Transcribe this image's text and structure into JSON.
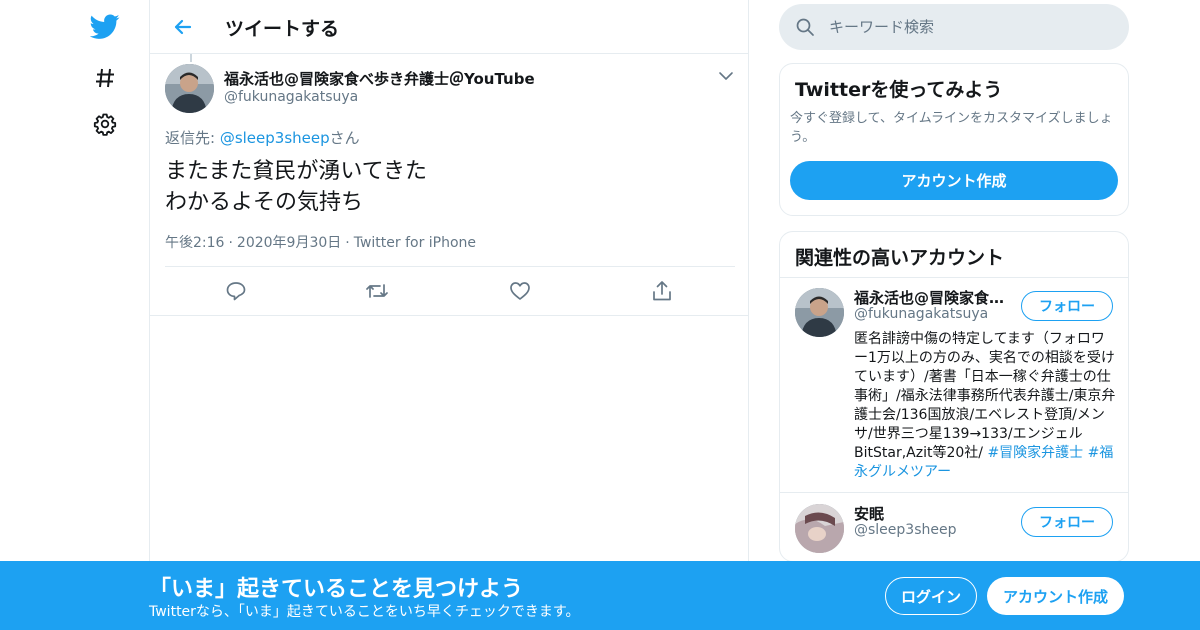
{
  "colors": {
    "accent": "#1da1f2",
    "link": "#1b95e0",
    "muted": "#657786",
    "border": "#e6ecf0"
  },
  "nav": {
    "icons": [
      "twitter-bird-icon",
      "hashtag-icon",
      "gear-icon"
    ]
  },
  "header": {
    "title": "ツイートする"
  },
  "tweet": {
    "author_name": "福永活也@冒険家食べ歩き弁護士＠YouTube",
    "author_handle": "@fukunagakatsuya",
    "reply_prefix": "返信先: ",
    "reply_handle": "@sleep3sheep",
    "reply_suffix": "さん",
    "text": "またまた貧民が湧いてきた\nわかるよその気持ち",
    "time": "午後2:16",
    "date": "2020年9月30日",
    "source": "Twitter for iPhone",
    "separator": "·"
  },
  "search": {
    "placeholder": "キーワード検索"
  },
  "signup_card": {
    "title": "Twitterを使ってみよう",
    "description": "今すぐ登録して、タイムラインをカスタマイズしましょう。",
    "button": "アカウント作成"
  },
  "related": {
    "title": "関連性の高いアカウント",
    "accounts": [
      {
        "name": "福永活也@冒険家食…",
        "handle": "@fukunagakatsuya",
        "follow": "フォロー",
        "bio": "匿名誹謗中傷の特定してます（フォロワー1万以上の方のみ、実名での相談を受けています）/著書「日本一稼ぐ弁護士の仕事術」/福永法律事務所代表弁護士/東京弁護士会/136国放浪/エベレスト登頂/メンサ/世界三つ星139→133/エンジェルBitStar,Azit等20社/ ",
        "tag1": "#冒険家弁護士",
        "tag2": "#福永グルメツアー"
      },
      {
        "name": "安眠",
        "handle": "@sleep3sheep",
        "follow": "フォロー"
      }
    ]
  },
  "bottom_bar": {
    "title": "「いま」起きていることを見つけよう",
    "subtitle": "Twitterなら、「いま」起きていることをいち早くチェックできます。",
    "login": "ログイン",
    "signup": "アカウント作成"
  }
}
